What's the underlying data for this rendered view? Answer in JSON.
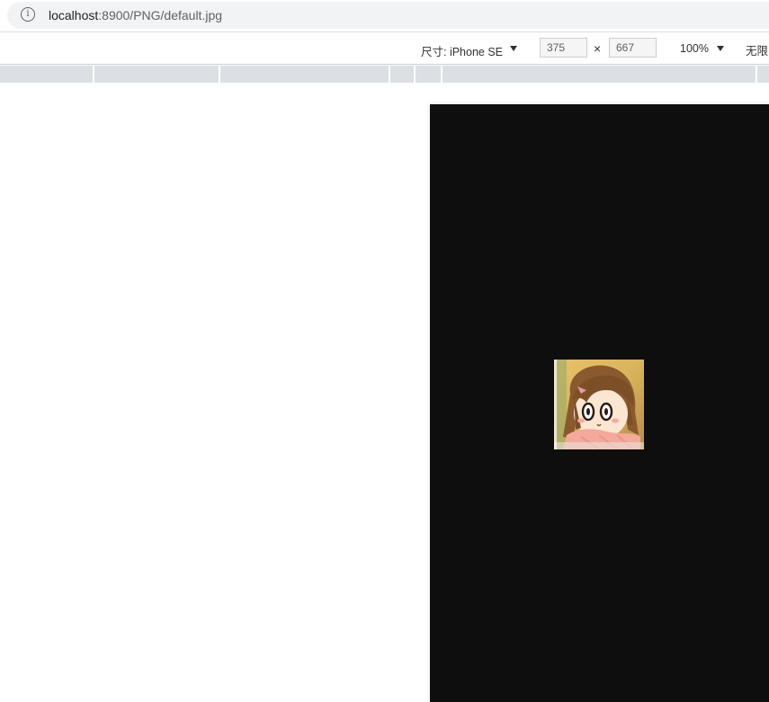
{
  "browser": {
    "info_icon": "info-icon",
    "url_host": "localhost",
    "url_path": ":8900/PNG/default.jpg"
  },
  "device_toolbar": {
    "dimensions_label": "尺寸: iPhone SE",
    "device_dropdown_icon": "caret-down-icon",
    "width_value": "375",
    "height_value": "667",
    "times_symbol": "×",
    "zoom_value": "100%",
    "zoom_dropdown_icon": "caret-down-icon",
    "throttling_label": "无限"
  },
  "page": {
    "background": "#0e0e0e",
    "image_alt": "default.jpg"
  }
}
